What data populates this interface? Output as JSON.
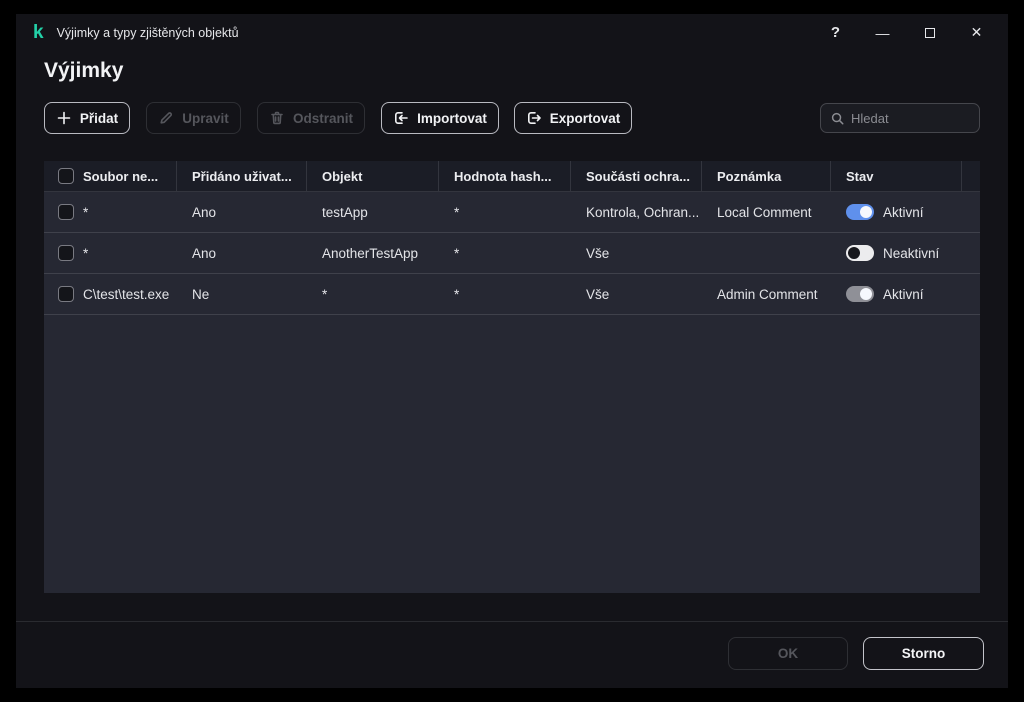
{
  "window": {
    "logo_glyph": "k",
    "title": "Výjimky a typy zjištěných objektů",
    "help": "?",
    "minimize": "—",
    "close": "✕"
  },
  "page": {
    "title": "Výjimky"
  },
  "toolbar": {
    "add": "Přidat",
    "edit": "Upravit",
    "remove": "Odstranit",
    "import": "Importovat",
    "export": "Exportovat",
    "search_placeholder": "Hledat"
  },
  "table": {
    "columns": {
      "file": "Soubor ne...",
      "added_by_user": "Přidáno uživat...",
      "object": "Objekt",
      "hash": "Hodnota hash...",
      "components": "Součásti ochra...",
      "comment": "Poznámka",
      "state": "Stav"
    },
    "rows": [
      {
        "file": "*",
        "added_by_user": "Ano",
        "object": "testApp",
        "hash": "*",
        "components": "Kontrola, Ochran...",
        "comment": "Local Comment",
        "state": "Aktivní",
        "toggle": "on-blue"
      },
      {
        "file": "*",
        "added_by_user": "Ano",
        "object": "AnotherTestApp",
        "hash": "*",
        "components": "Vše",
        "comment": "",
        "state": "Neaktivní",
        "toggle": "off"
      },
      {
        "file": "C\\test\\test.exe",
        "added_by_user": "Ne",
        "object": "*",
        "hash": "*",
        "components": "Vše",
        "comment": "Admin Comment",
        "state": "Aktivní",
        "toggle": "on-gray"
      }
    ]
  },
  "footer": {
    "ok": "OK",
    "cancel": "Storno"
  },
  "colors": {
    "brand_green": "#23d1a8",
    "toggle_on": "#5f90ec",
    "toggle_off_track": "#ececee",
    "toggle_disabled": "#8f9097",
    "table_bg": "#262833",
    "header_bg": "#1b1d26",
    "window_bg": "#131318"
  }
}
